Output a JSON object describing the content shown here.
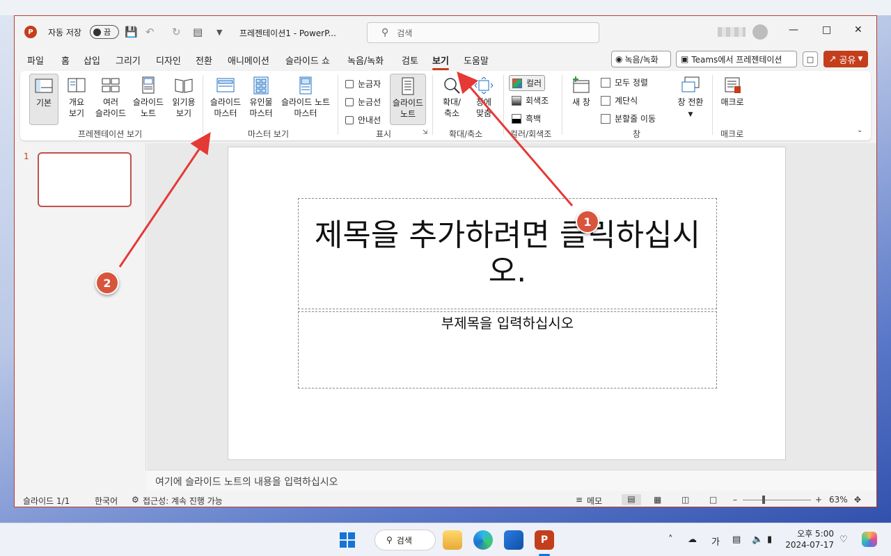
{
  "window": {
    "autosave_label": "자동 저장",
    "autosave_state": "끔",
    "doc_title": "프레젠테이션1  -  PowerP...",
    "search_placeholder": "검색"
  },
  "menu": {
    "items": [
      "파일",
      "홈",
      "삽입",
      "그리기",
      "디자인",
      "전환",
      "애니메이션",
      "슬라이드 쇼",
      "녹음/녹화",
      "검토",
      "보기",
      "도움말"
    ],
    "active": "보기",
    "record_btn": "녹음/녹화",
    "teams_btn": "Teams에서 프레젠테이션",
    "share_btn": "공유"
  },
  "ribbon": {
    "presentation_views": {
      "label": "프레젠테이션 보기",
      "buttons": [
        {
          "line1": "기본",
          "line2": ""
        },
        {
          "line1": "개요",
          "line2": "보기"
        },
        {
          "line1": "여러",
          "line2": "슬라이드"
        },
        {
          "line1": "슬라이드",
          "line2": "노트"
        },
        {
          "line1": "읽기용",
          "line2": "보기"
        }
      ]
    },
    "master_views": {
      "label": "마스터 보기",
      "buttons": [
        {
          "line1": "슬라이드",
          "line2": "마스터"
        },
        {
          "line1": "유인물",
          "line2": "마스터"
        },
        {
          "line1": "슬라이드 노트",
          "line2": "마스터"
        }
      ]
    },
    "show": {
      "label": "표시",
      "ruler": "눈금자",
      "gridlines": "눈금선",
      "guides": "안내선",
      "notes_line1": "슬라이드",
      "notes_line2": "노트"
    },
    "zoom": {
      "label": "확대/축소",
      "zoom_line1": "확대/",
      "zoom_line2": "축소",
      "fit_line1": "창에",
      "fit_line2": "맞춤"
    },
    "color": {
      "label": "컬러/회색조",
      "color": "컬러",
      "grayscale": "회색조",
      "bw": "흑백"
    },
    "window": {
      "label": "창",
      "new_window": "새 창",
      "arrange_all": "모두 정렬",
      "cascade": "계단식",
      "move_split": "분할줄 이동",
      "switch_line1": "창 전환"
    },
    "macros": {
      "label": "매크로",
      "button": "매크로"
    }
  },
  "slides": {
    "number": "1",
    "title_placeholder": "제목을 추가하려면 클릭하십시오.",
    "subtitle_placeholder": "부제목을 입력하십시오",
    "notes_placeholder": "여기에 슬라이드 노트의 내용을 입력하십시오"
  },
  "status": {
    "slide_count": "슬라이드 1/1",
    "language": "한국어",
    "accessibility": "접근성: 계속 진행 가능",
    "notes": "메모",
    "zoom": "63%"
  },
  "taskbar": {
    "search": "검색",
    "ime": "가",
    "time": "오후 5:00",
    "date": "2024-07-17"
  },
  "annotations": {
    "marker1": "1",
    "marker2": "2",
    "accent": "#d9543c"
  }
}
